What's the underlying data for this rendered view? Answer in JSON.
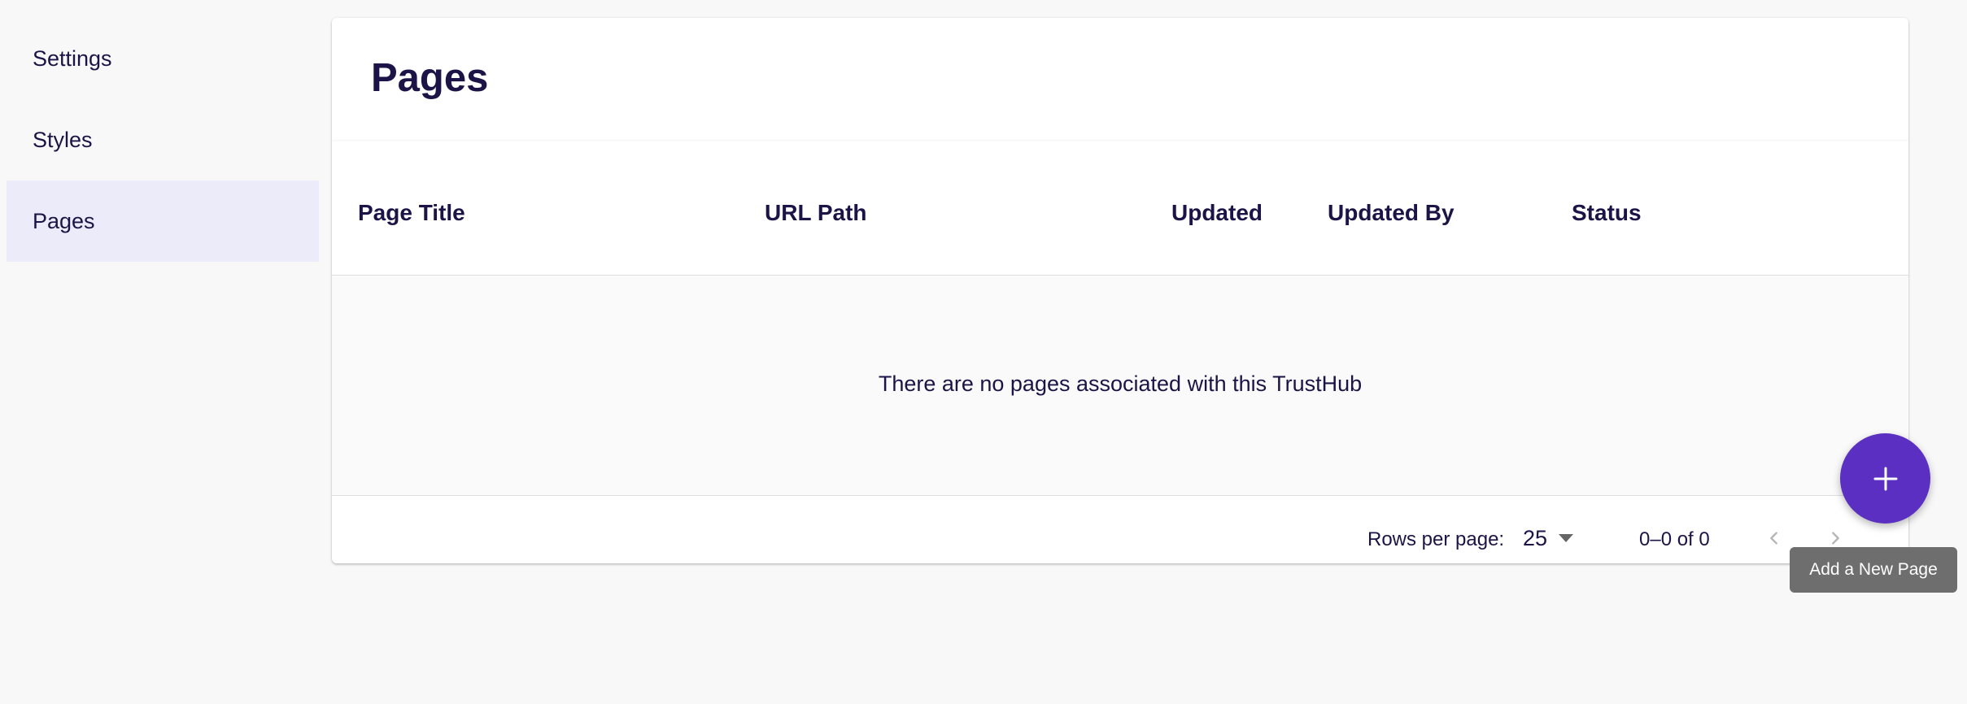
{
  "sidebar": {
    "items": [
      {
        "label": "Settings",
        "active": false
      },
      {
        "label": "Styles",
        "active": false
      },
      {
        "label": "Pages",
        "active": true
      }
    ]
  },
  "main": {
    "title": "Pages",
    "table": {
      "columns": [
        "Page Title",
        "URL Path",
        "Updated",
        "Updated By",
        "Status"
      ],
      "rows": [],
      "empty_message": "There are no pages associated with this TrustHub"
    },
    "pagination": {
      "rows_per_page_label": "Rows per page:",
      "rows_per_page_value": "25",
      "range_text": "0–0 of 0",
      "prev_icon": "chevron-left-icon",
      "next_icon": "chevron-right-icon"
    }
  },
  "fab": {
    "icon": "plus-icon",
    "tooltip": "Add a New Page",
    "color": "#5b2fc2"
  },
  "colors": {
    "text": "#1c1446",
    "active_nav_bg": "#ecebf9",
    "page_bg": "#f8f8f8"
  }
}
